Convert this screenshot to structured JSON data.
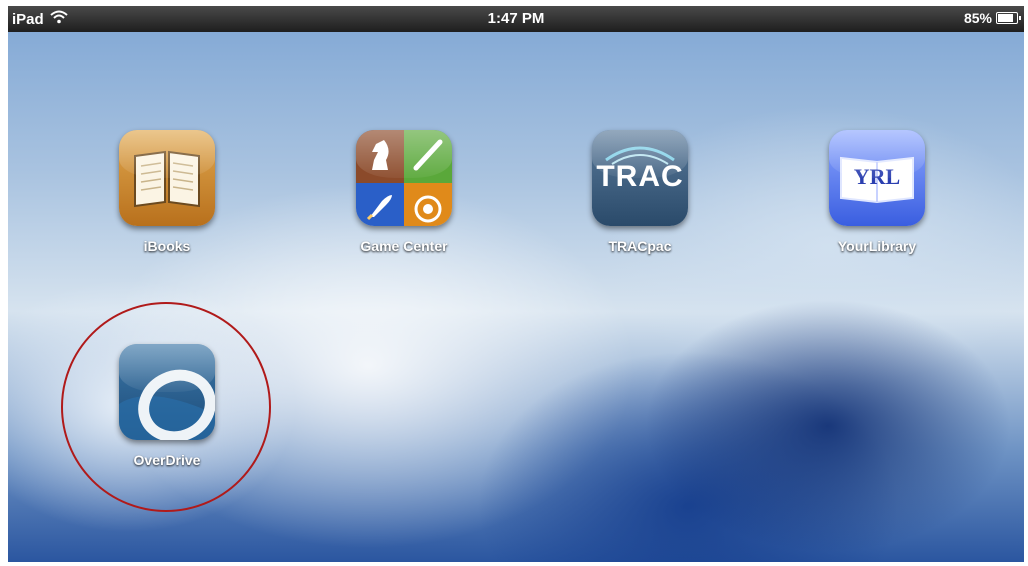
{
  "statusbar": {
    "device": "iPad",
    "time": "1:47 PM",
    "battery": "85%",
    "battery_level": 0.85,
    "wifi_icon": "wifi-icon",
    "battery_icon": "battery-icon"
  },
  "apps": [
    {
      "label": "iBooks",
      "icon": "ibooks-icon"
    },
    {
      "label": "Game Center",
      "icon": "game-center-icon"
    },
    {
      "label": "TRACpac",
      "icon": "tracpac-icon",
      "icon_text": "TRAC"
    },
    {
      "label": "YourLibrary",
      "icon": "yourlibrary-icon",
      "icon_text": "YRL"
    },
    {
      "label": "OverDrive",
      "icon": "overdrive-icon"
    }
  ],
  "colors": {
    "statusbar": "#2a2a2a",
    "highlight_circle": "#b01a1a",
    "label_text": "#ffffff"
  }
}
